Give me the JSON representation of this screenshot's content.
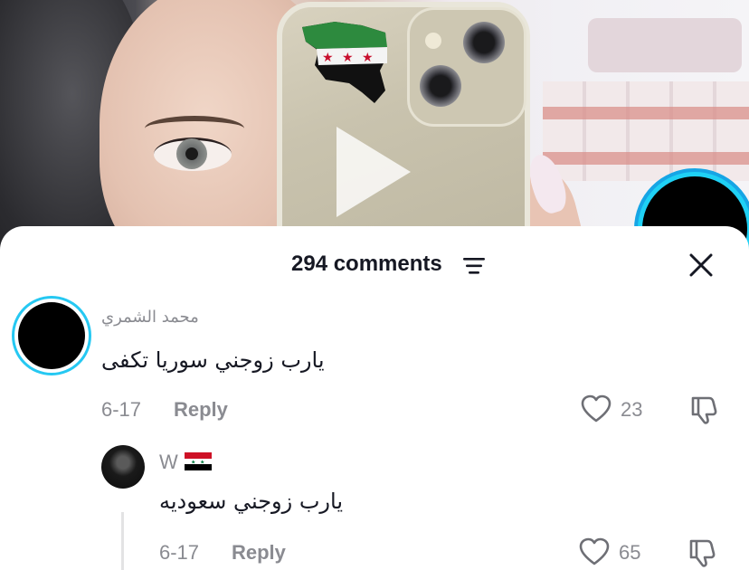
{
  "header": {
    "comment_count_label": "294 comments"
  },
  "comments": [
    {
      "username": "محمد الشمري",
      "text": "يارب زوجني سوريا تكفى",
      "date": "6-17",
      "reply_label": "Reply",
      "likes": "23"
    }
  ],
  "replies": [
    {
      "username": "W",
      "text": "يارب زوجني سعوديه",
      "date": "6-17",
      "reply_label": "Reply",
      "likes": "65"
    }
  ],
  "icons": {
    "filter": "filter-icon",
    "close": "close-icon",
    "like": "heart-icon",
    "dislike": "thumbs-down-icon",
    "play": "play-icon"
  },
  "colors": {
    "live_ring": "#1fd1f5",
    "text_primary": "#161823",
    "text_secondary": "#8a8b91"
  }
}
